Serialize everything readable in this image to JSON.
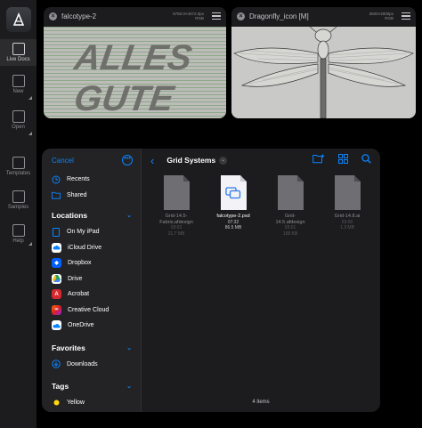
{
  "toolbar": {
    "items": [
      {
        "label": "Live Docs",
        "icon": "pencil-doc-icon"
      },
      {
        "label": "New",
        "icon": "new-doc-icon"
      },
      {
        "label": "Open",
        "icon": "open-icon"
      },
      {
        "label": "Templates",
        "icon": "templates-icon"
      },
      {
        "label": "Samples",
        "icon": "samples-icon"
      },
      {
        "label": "Help",
        "icon": "help-icon"
      }
    ]
  },
  "cards": [
    {
      "title": "falcotype-2",
      "meta_line1": "5750.0×4072.0px",
      "meta_line2": "RGB"
    },
    {
      "title": "Dragonfly_icon [M]",
      "meta_line1": "3500×2000px",
      "meta_line2": "RGB"
    }
  ],
  "artwork_text": [
    "ALLES",
    "GUTE"
  ],
  "browser": {
    "cancel": "Cancel",
    "more": "•••",
    "recents": "Recents",
    "shared": "Shared",
    "locations_title": "Locations",
    "locations": [
      {
        "label": "On My iPad",
        "icon": "ipad-icon",
        "color": "#0a84ff"
      },
      {
        "label": "iCloud Drive",
        "icon": "icloud-icon",
        "color": "#0a84ff"
      },
      {
        "label": "Dropbox",
        "icon": "dropbox-icon",
        "color": "#0061fe"
      },
      {
        "label": "Drive",
        "icon": "google-drive-icon",
        "color": "#1fa463"
      },
      {
        "label": "Acrobat",
        "icon": "acrobat-icon",
        "color": "#d7282f"
      },
      {
        "label": "Creative Cloud",
        "icon": "creative-cloud-icon",
        "color": "#da1f26"
      },
      {
        "label": "OneDrive",
        "icon": "onedrive-icon",
        "color": "#0a84ff"
      }
    ],
    "favorites_title": "Favorites",
    "favorites": [
      {
        "label": "Downloads",
        "icon": "downloads-icon"
      }
    ],
    "tags_title": "Tags",
    "tags": [
      {
        "label": "Yellow",
        "color": "#ffd60a"
      }
    ],
    "folder": "Grid Systems",
    "files": [
      {
        "name1": "Grid-14.5-",
        "name2": "Fabris.afdesign",
        "meta1": "03:02",
        "meta2": "31.7 MB",
        "selected": false
      },
      {
        "name1": "falcotype-2.psd",
        "name2": "",
        "meta1": "07:32",
        "meta2": "86.5 MB",
        "selected": true
      },
      {
        "name1": "Grid-14.5.afdesign",
        "name2": "",
        "meta1": "03:01",
        "meta2": "158 KB",
        "selected": false
      },
      {
        "name1": "Grid-14.8.ai",
        "name2": "",
        "meta1": "03:00",
        "meta2": "1.3 MB",
        "selected": false
      }
    ],
    "item_count": "4 items"
  }
}
